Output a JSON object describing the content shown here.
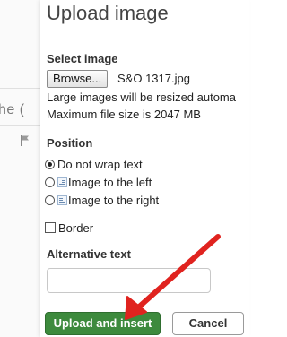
{
  "background": {
    "partial_text": "he (",
    "flag_icon": "flag-icon"
  },
  "dialog": {
    "title": "Upload image",
    "select_image": {
      "label": "Select image",
      "browse_label": "Browse...",
      "file_name": "S&O 1317.jpg",
      "help_resize": "Large images will be resized automa",
      "help_max_size": "Maximum file size is 2047 MB"
    },
    "position": {
      "label": "Position",
      "options": [
        {
          "label": "Do not wrap text",
          "selected": true
        },
        {
          "label": "Image to the left",
          "selected": false,
          "icon": "wrap-left-icon"
        },
        {
          "label": "Image to the right",
          "selected": false,
          "icon": "wrap-right-icon"
        }
      ]
    },
    "border": {
      "label": "Border",
      "checked": false
    },
    "alt_text": {
      "label": "Alternative text",
      "value": ""
    },
    "buttons": {
      "upload_insert": "Upload and insert",
      "cancel": "Cancel"
    }
  },
  "colors": {
    "primary_button": "#3d8a3d",
    "annotation_arrow": "#e0231f"
  }
}
